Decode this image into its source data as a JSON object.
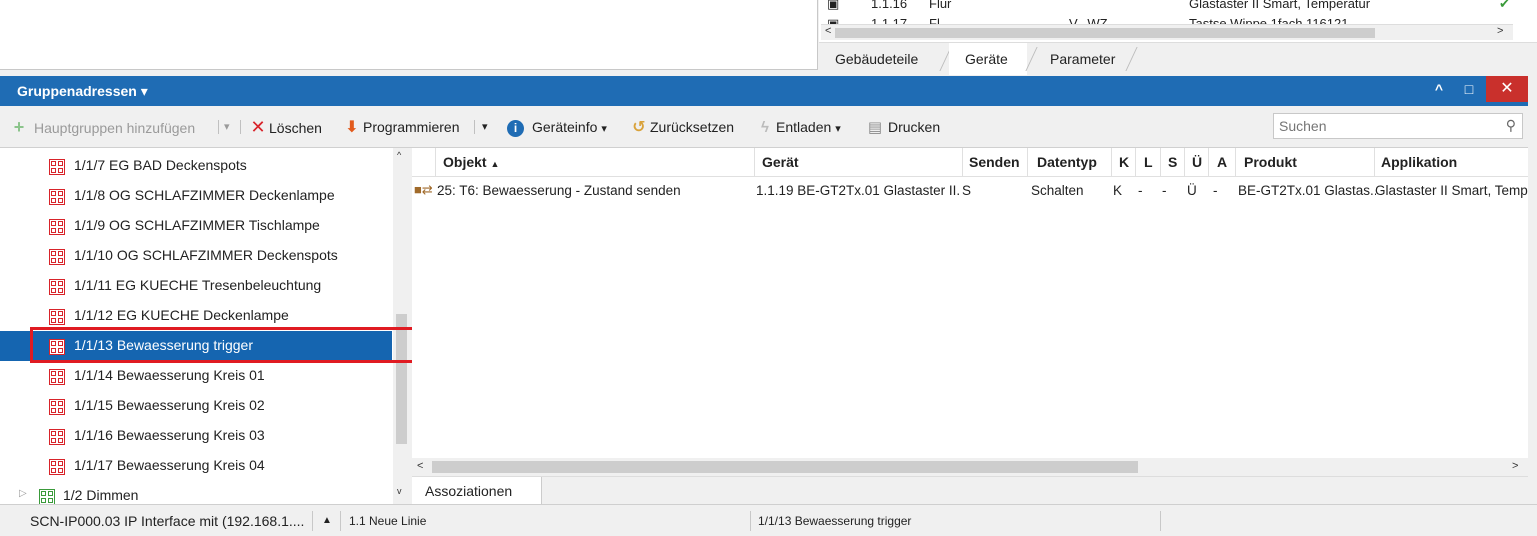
{
  "top_list": {
    "rows": [
      {
        "address": "1.1.16",
        "room": "Flur",
        "extra": "",
        "product": "Glastaster II Smart, Temperatur"
      },
      {
        "address": "1.1.17",
        "room": "Fl...",
        "extra": "V...WZ",
        "product": "Tastse Wippe 1fach 116121"
      }
    ]
  },
  "top_tabs": [
    "Gebäudeteile",
    "Geräte",
    "Parameter"
  ],
  "panel": {
    "title": "Gruppenadressen",
    "title_caret": "▾",
    "minimize_glyph": "^",
    "maximize_glyph": "□",
    "close_glyph": "✕"
  },
  "toolbar": {
    "add_main_groups": "Hauptgruppen hinzufügen",
    "delete": "Löschen",
    "program": "Programmieren",
    "device_info": "Geräteinfo",
    "reset": "Zurücksetzen",
    "unload": "Entladen",
    "print": "Drucken",
    "search_placeholder": "Suchen"
  },
  "tree": {
    "items": [
      {
        "label": "1/1/7 EG BAD Deckenspots"
      },
      {
        "label": "1/1/8 OG SCHLAFZIMMER Deckenlampe"
      },
      {
        "label": "1/1/9 OG SCHLAFZIMMER Tischlampe"
      },
      {
        "label": "1/1/10 OG SCHLAFZIMMER Deckenspots"
      },
      {
        "label": "1/1/11 EG KUECHE Tresenbeleuchtung"
      },
      {
        "label": "1/1/12 EG KUECHE Deckenlampe"
      },
      {
        "label": "1/1/13 Bewaesserung trigger"
      },
      {
        "label": "1/1/14 Bewaesserung Kreis 01"
      },
      {
        "label": "1/1/15 Bewaesserung Kreis 02"
      },
      {
        "label": "1/1/16 Bewaesserung Kreis 03"
      },
      {
        "label": "1/1/17 Bewaesserung Kreis 04"
      }
    ],
    "group_item": "1/2 Dimmen",
    "selected_index": 6
  },
  "table": {
    "columns": {
      "object": "Objekt",
      "device": "Gerät",
      "send": "Senden",
      "datatype": "Datentyp",
      "k": "K",
      "l": "L",
      "s": "S",
      "u": "Ü",
      "a": "A",
      "product": "Produkt",
      "application": "Applikation"
    },
    "sort_indicator": "▲",
    "rows": [
      {
        "object": "25: T6: Bewaesserung - Zustand senden",
        "device": "1.1.19 BE-GT2Tx.01 Glastaster II...",
        "send": "S",
        "datatype": "Schalten",
        "k": "K",
        "l": "-",
        "s": "-",
        "u": "Ü",
        "a": "-",
        "product": "BE-GT2Tx.01 Glastas...",
        "application": "Glastaster II Smart, Temp"
      }
    ]
  },
  "bottom_tabs": [
    "Assoziationen"
  ],
  "status_bar": {
    "interface": "SCN-IP000.03 IP Interface mit  (192.168.1....",
    "line": "1.1 Neue Linie",
    "selection": "1/1/13 Bewaesserung trigger"
  },
  "colors": {
    "header_blue": "#1f6cb4",
    "selection_blue": "#1565b0",
    "highlight_red": "#e01b22",
    "group_icon_red": "#d8232a",
    "group_icon_green": "#3a9a3a"
  }
}
